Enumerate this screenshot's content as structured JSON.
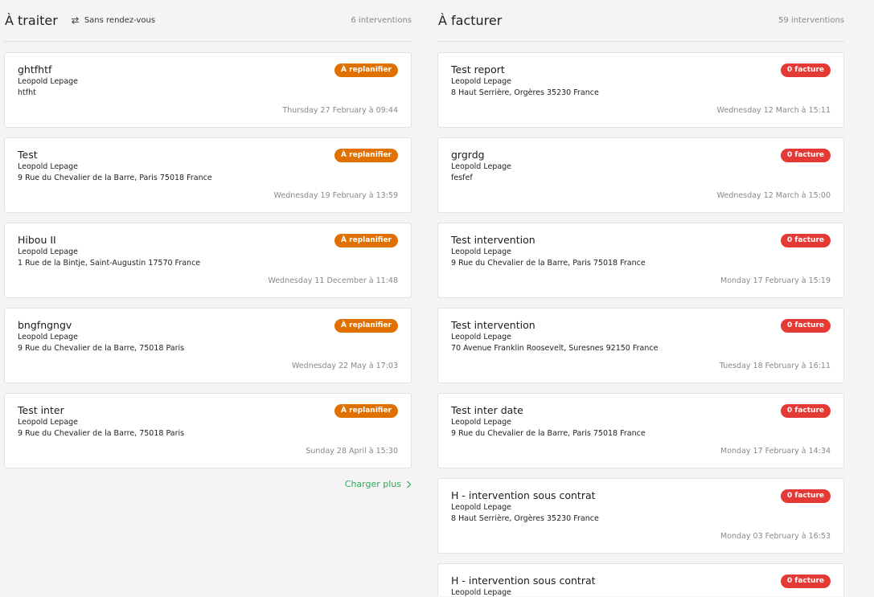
{
  "left": {
    "title": "À traiter",
    "toggle_label": "Sans rendez-vous",
    "count": "6 interventions",
    "load_more": "Charger plus",
    "cards": [
      {
        "title": "ghtfhtf",
        "client": "Leopold Lepage",
        "address": "htfht",
        "date": "Thursday 27 February à 09:44",
        "badge": "À replanifier"
      },
      {
        "title": "Test",
        "client": "Leopold Lepage",
        "address": "9 Rue du Chevalier de la Barre, Paris 75018 France",
        "date": "Wednesday 19 February à 13:59",
        "badge": "À replanifier"
      },
      {
        "title": "Hibou II",
        "client": "Leopold Lepage",
        "address": "1 Rue de la Bintje, Saint-Augustin 17570 France",
        "date": "Wednesday 11 December à 11:48",
        "badge": "À replanifier"
      },
      {
        "title": "bngfngngv",
        "client": "Leopold Lepage",
        "address": "9 Rue du Chevalier de la Barre, 75018 Paris",
        "date": "Wednesday 22 May à 17:03",
        "badge": "À replanifier"
      },
      {
        "title": "Test inter",
        "client": "Leopold Lepage",
        "address": "9 Rue du Chevalier de la Barre, 75018 Paris",
        "date": "Sunday 28 April à 15:30",
        "badge": "À replanifier"
      }
    ]
  },
  "right": {
    "title": "À facturer",
    "count": "59 interventions",
    "cards": [
      {
        "title": "Test report",
        "client": "Leopold Lepage",
        "address": "8 Haut Serrière, Orgères 35230 France",
        "date": "Wednesday 12 March à 15:11",
        "badge": "0 facture"
      },
      {
        "title": "grgrdg",
        "client": "Leopold Lepage",
        "address": "fesfef",
        "date": "Wednesday 12 March à 15:00",
        "badge": "0 facture"
      },
      {
        "title": "Test intervention",
        "client": "Leopold Lepage",
        "address": "9 Rue du Chevalier de la Barre, Paris 75018 France",
        "date": "Monday 17 February à 15:19",
        "badge": "0 facture"
      },
      {
        "title": "Test intervention",
        "client": "Leopold Lepage",
        "address": "70 Avenue Franklin Roosevelt, Suresnes 92150 France",
        "date": "Tuesday 18 February à 16:11",
        "badge": "0 facture"
      },
      {
        "title": "Test inter date",
        "client": "Leopold Lepage",
        "address": "9 Rue du Chevalier de la Barre, Paris 75018 France",
        "date": "Monday 17 February à 14:34",
        "badge": "0 facture"
      },
      {
        "title": "H - intervention sous contrat",
        "client": "Leopold Lepage",
        "address": "8 Haut Serrière, Orgères 35230 France",
        "date": "Monday 03 February à 16:53",
        "badge": "0 facture"
      },
      {
        "title": "H - intervention sous contrat",
        "client": "Leopold Lepage",
        "badge": "0 facture"
      }
    ]
  },
  "colors": {
    "badge_orange": "#e07000",
    "badge_red": "#e53935",
    "load_more": "#2eaa57"
  },
  "icons": {
    "toggle": "swap-arrows-icon",
    "load_more": "chevron-right-icon"
  }
}
